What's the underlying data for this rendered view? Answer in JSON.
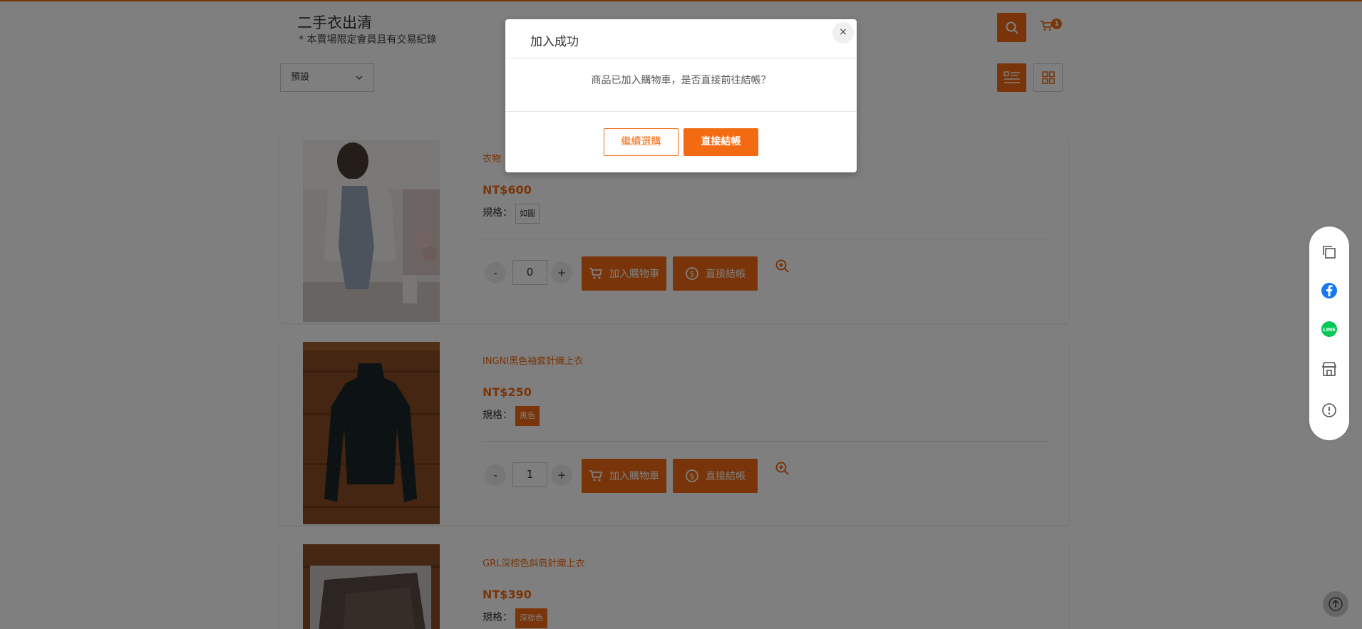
{
  "header": {
    "store_title": "二手衣出清",
    "store_subtitle": "* 本賣場限定會員且有交易紀錄",
    "cart_count": "1"
  },
  "toolbar": {
    "sort_selected": "預設"
  },
  "products": [
    {
      "name": "衣物",
      "price": "NT$600",
      "spec_label": "規格：",
      "spec_option": "如圖",
      "spec_active": false,
      "quantity": "0",
      "add_to_cart_label": "加入購物車",
      "checkout_label": "直接結帳"
    },
    {
      "name": "INGNI黑色袖套針織上衣",
      "price": "NT$250",
      "spec_label": "規格：",
      "spec_option": "黑色",
      "spec_active": true,
      "quantity": "1",
      "add_to_cart_label": "加入購物車",
      "checkout_label": "直接結帳"
    },
    {
      "name": "GRL深棕色斜肩針織上衣",
      "price": "NT$390",
      "spec_label": "規格：",
      "spec_option": "深棕色",
      "spec_active": true
    }
  ],
  "qty_controls": {
    "minus": "-",
    "plus": "+"
  },
  "modal": {
    "title": "加入成功",
    "close": "×",
    "message": "商品已加入購物車，是否直接前往結帳？",
    "continue_label": "繼續選購",
    "checkout_label": "直接結帳"
  },
  "colors": {
    "accent": "#f26b12"
  },
  "icons": [
    "search-icon",
    "cart-icon",
    "chevron-down-icon",
    "list-view-icon",
    "grid-view-icon",
    "zoom-icon",
    "copy-icon",
    "facebook-icon",
    "line-icon",
    "store-icon",
    "report-icon",
    "arrow-up-icon"
  ]
}
